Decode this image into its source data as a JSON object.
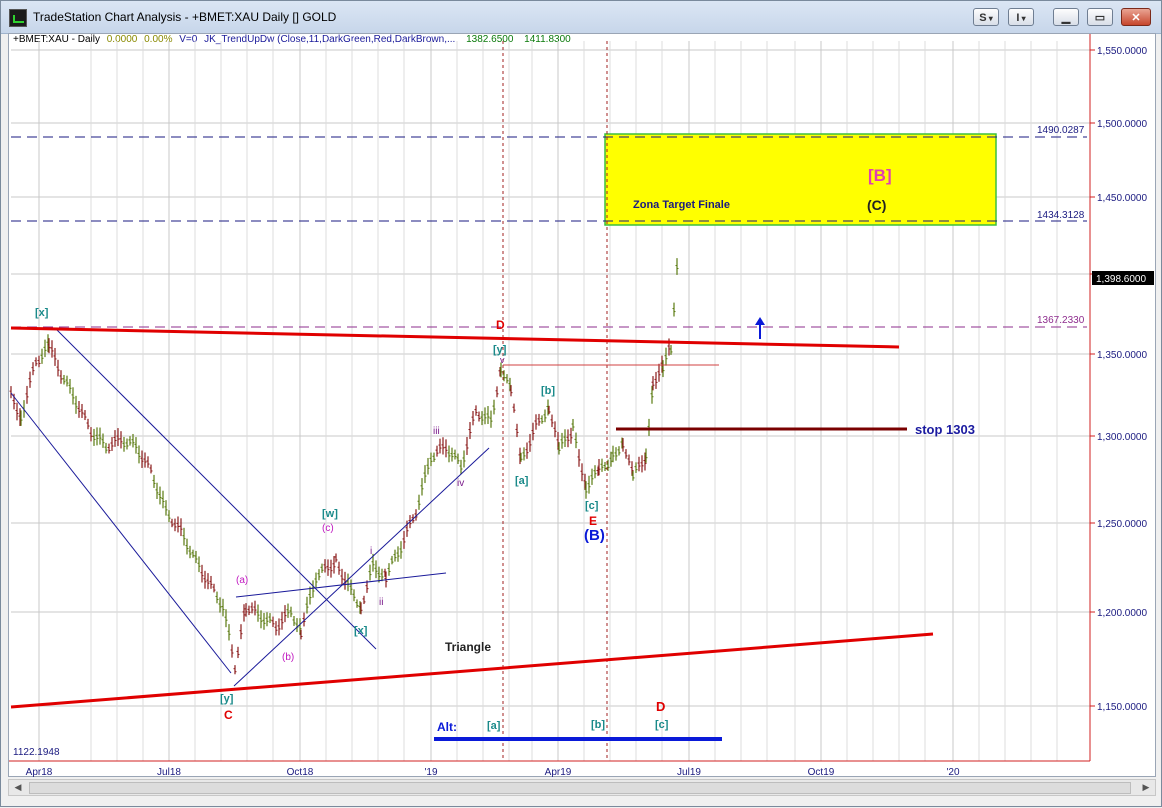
{
  "window": {
    "title": "TradeStation Chart Analysis - +BMET:XAU Daily [] GOLD",
    "btn_s": "S",
    "btn_i": "I"
  },
  "infobar": {
    "symbol": "+BMET:XAU - Daily",
    "change": "0.0000",
    "pct": "0.00%",
    "volume": "V=0",
    "indicator": "JK_TrendUpDw (Close,11,DarkGreen,Red,DarkBrown,...",
    "val1": "1382.6500",
    "val2": "1411.8300"
  },
  "price_axis": {
    "ticks": [
      "1,550.0000",
      "1,500.0000",
      "1,450.0000",
      "1,400.0000",
      "1,350.0000",
      "1,300.0000",
      "1,250.0000",
      "1,200.0000",
      "1,150.0000"
    ],
    "current": "1,398.6000",
    "min_label": "1122.1948"
  },
  "time_axis": {
    "ticks": [
      "Apr18",
      "Jul18",
      "Oct18",
      "'19",
      "Apr19",
      "Jul19",
      "Oct19",
      "'20"
    ]
  },
  "levels": [
    {
      "label": "1490.0287",
      "color": "#1a1a80"
    },
    {
      "label": "1434.3128",
      "color": "#1a1a80"
    },
    {
      "label": "1367.2330",
      "color": "#8e2d8e"
    }
  ],
  "target_zone": {
    "label": "Zona Target Finale",
    "wave_b": "[B]",
    "wave_c": "(C)",
    "fill": "#ffff00",
    "border": "#3cbf3c"
  },
  "stop": {
    "label": "stop 1303",
    "color": "#7a0000"
  },
  "annotations": {
    "x1": "[x]",
    "C": "C",
    "y1": "[y]",
    "a_small": "(a)",
    "b_small": "(b)",
    "c_small": "(c)",
    "w": "[w]",
    "x2": "[x]",
    "i": "i",
    "ii": "ii",
    "iii": "iii",
    "iv": "iv",
    "D_top": "D",
    "y_top": "[y]",
    "v": "v",
    "a_bracket": "[a]",
    "b_bracket": "[b]",
    "c_bracket": "[c]",
    "E": "E",
    "B_paren": "(B)",
    "triangle": "Triangle",
    "alt": "Alt:",
    "alt_a": "[a]",
    "alt_b": "[b]",
    "alt_c": "[c]",
    "D_bottom": "D"
  },
  "colors": {
    "wave_red": "#e00000",
    "wave_teal": "#1a8a8a",
    "wave_magenta": "#c018c0",
    "wave_blue": "#0a1ad8",
    "wave_purple": "#7a1a8a",
    "channel": "#1a1a9a"
  }
}
